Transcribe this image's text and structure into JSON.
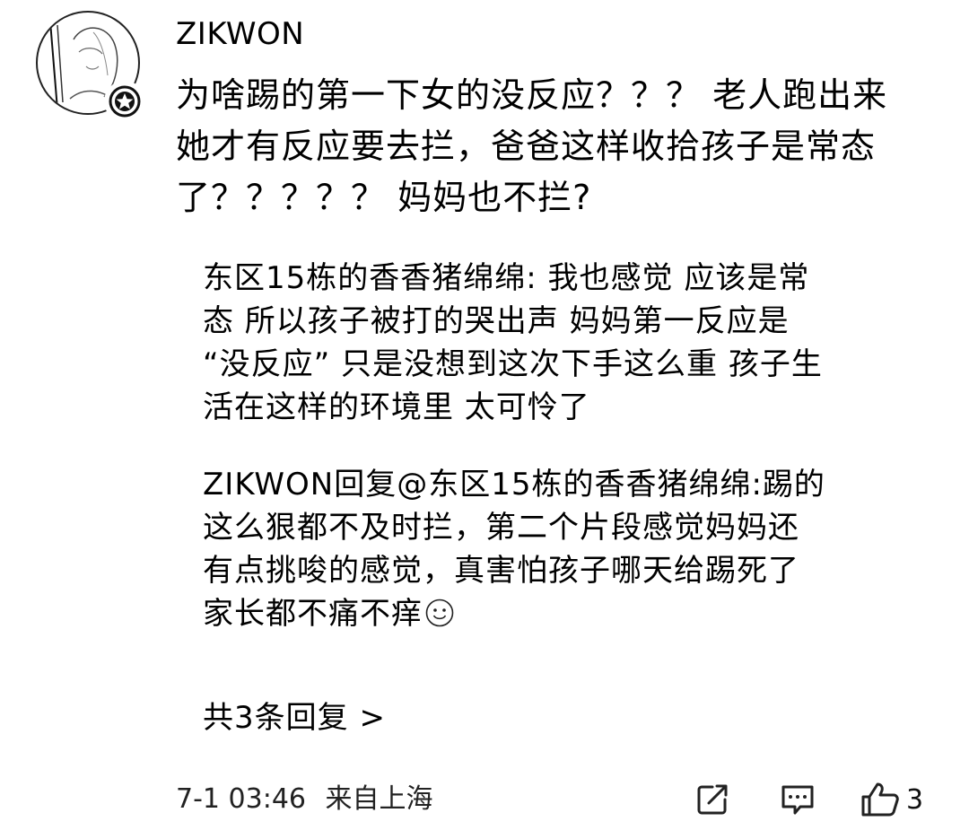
{
  "comment": {
    "username": "ZIKWON",
    "text_lines": [
      "为啥踢的第一下女的没反应？？？ 老人跑出来",
      "她才有反应要去拦，爸爸这样收拾孩子是常态",
      "了？？？？？ 妈妈也不拦?"
    ],
    "replies": [
      {
        "lines": [
          "东区15栋的香香猪绵绵: 我也感觉  应该是常",
          "态  所以孩子被打的哭出声 妈妈第一反应是",
          "“没反应” 只是没想到这次下手这么重 孩子生",
          "活在这样的环境里  太可怜了"
        ]
      },
      {
        "lines": [
          "ZIKWON回复@东区15栋的香香猪绵绵:踢的",
          "这么狠都不及时拦，第二个片段感觉妈妈还",
          "有点挑唆的感觉，真害怕孩子哪天给踢死了",
          "家长都不痛不痒"
        ],
        "emoji": "smile-emoji"
      }
    ],
    "more_replies": "共3条回复 >",
    "time": "7-1 03:46",
    "location": "来自上海",
    "like_count": "3"
  },
  "icons": {
    "share": "share-icon",
    "comment": "comment-icon",
    "like": "thumbs-up-icon",
    "badge": "star-badge-icon"
  }
}
